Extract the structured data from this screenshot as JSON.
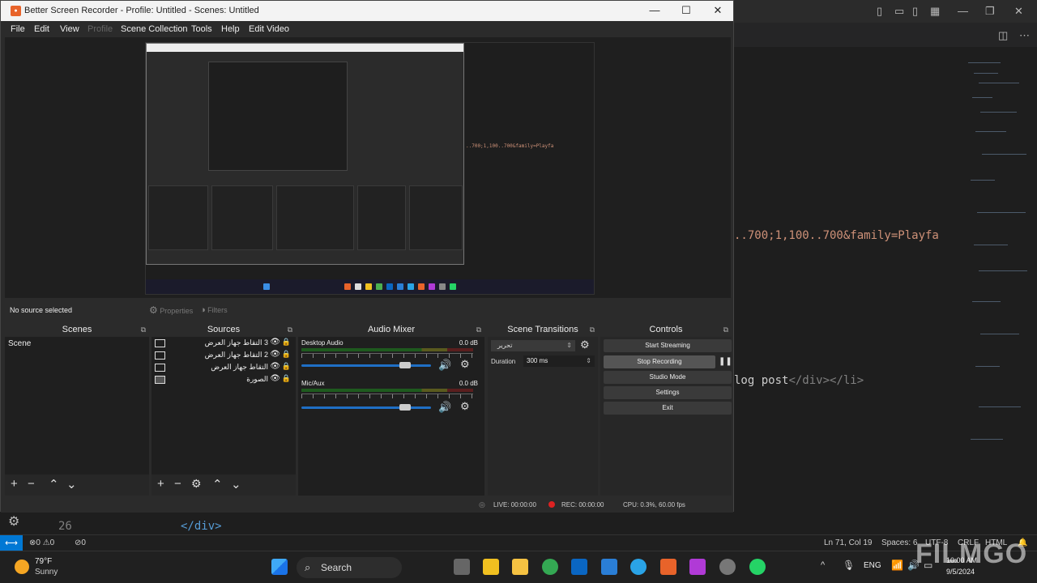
{
  "obs": {
    "title": "Better Screen Recorder - Profile: Untitled - Scenes: Untitled",
    "menu": [
      "File",
      "Edit",
      "View",
      "Profile",
      "Scene Collection",
      "Tools",
      "Help",
      "Edit Video"
    ],
    "no_source": "No source selected",
    "properties_label": "Properties",
    "filters_label": "Filters",
    "docks": {
      "scenes": "Scenes",
      "sources": "Sources",
      "mixer": "Audio Mixer",
      "transitions": "Scene Transitions",
      "controls": "Controls"
    },
    "scene_item": "Scene",
    "sources": [
      {
        "name": "3 التقاط جهاز العرض"
      },
      {
        "name": "2 التقاط جهاز العرض"
      },
      {
        "name": "التقاط جهاز العرض"
      },
      {
        "name": "الصورة"
      }
    ],
    "mixer": [
      {
        "name": "Desktop Audio",
        "db": "0.0 dB",
        "volume": 0.8
      },
      {
        "name": "Mic/Aux",
        "db": "0.0 dB",
        "volume": 0.8
      }
    ],
    "transition": {
      "value": "تحرير",
      "duration_label": "Duration",
      "duration_value": "300 ms"
    },
    "controls": {
      "start_streaming": "Start Streaming",
      "stop_recording": "Stop Recording",
      "studio_mode": "Studio Mode",
      "settings": "Settings",
      "exit": "Exit"
    },
    "status": {
      "live": "LIVE: 00:00:00",
      "rec": "REC: 00:00:00",
      "cpu": "CPU: 0.3%, 60.00 fps"
    }
  },
  "vscode": {
    "code_line_1": "..700;1,100..700&family=Playfa",
    "code_line_2_text": "log post",
    "code_line_2_tag": "</div></li>",
    "gutter_line_number": "26",
    "bottom_tag": "</div>",
    "status": {
      "problems": "⊗0 ⚠0",
      "ports": "⊘0",
      "cursor": "Ln 71, Col 19",
      "spaces": "Spaces: 6",
      "encoding": "UTF-8",
      "eol": "CRLF",
      "language": "HTML"
    }
  },
  "taskbar": {
    "weather_temp": "79°F",
    "weather_desc": "Sunny",
    "search": "Search",
    "lang": "ENG",
    "time": "10:00 AM",
    "date": "9/5/2024"
  },
  "watermark": "FILMGO"
}
